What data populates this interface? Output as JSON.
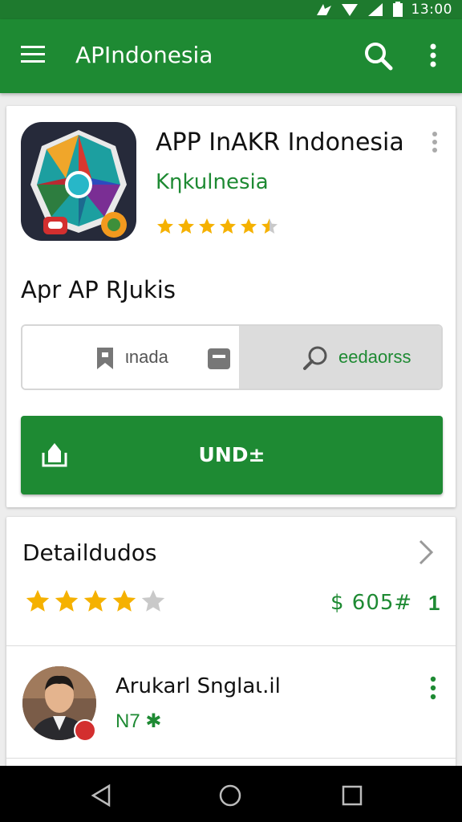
{
  "status_bar": {
    "time": "13:00"
  },
  "app_bar": {
    "title": "APIndonesia"
  },
  "app": {
    "name": "APP InAKR Indonesia",
    "developer": "Kηkulnesia",
    "rating_stars": 4.5,
    "section_title": "Apr AP RJukis",
    "segment_left_label": "ιnada",
    "segment_right_label": "eedaorss",
    "install_label": "UND±"
  },
  "details": {
    "title": "Detaildudos",
    "rating_stars": 4,
    "price": "$ 605#",
    "price_count": "1"
  },
  "review": {
    "reviewer": "Arukarl Snglаι.il",
    "meta": "N7 ✱"
  },
  "colors": {
    "primary": "#1e8a33",
    "status_bar": "#1e7a2e",
    "star": "#f5b100",
    "star_empty": "#c9c9c9"
  }
}
